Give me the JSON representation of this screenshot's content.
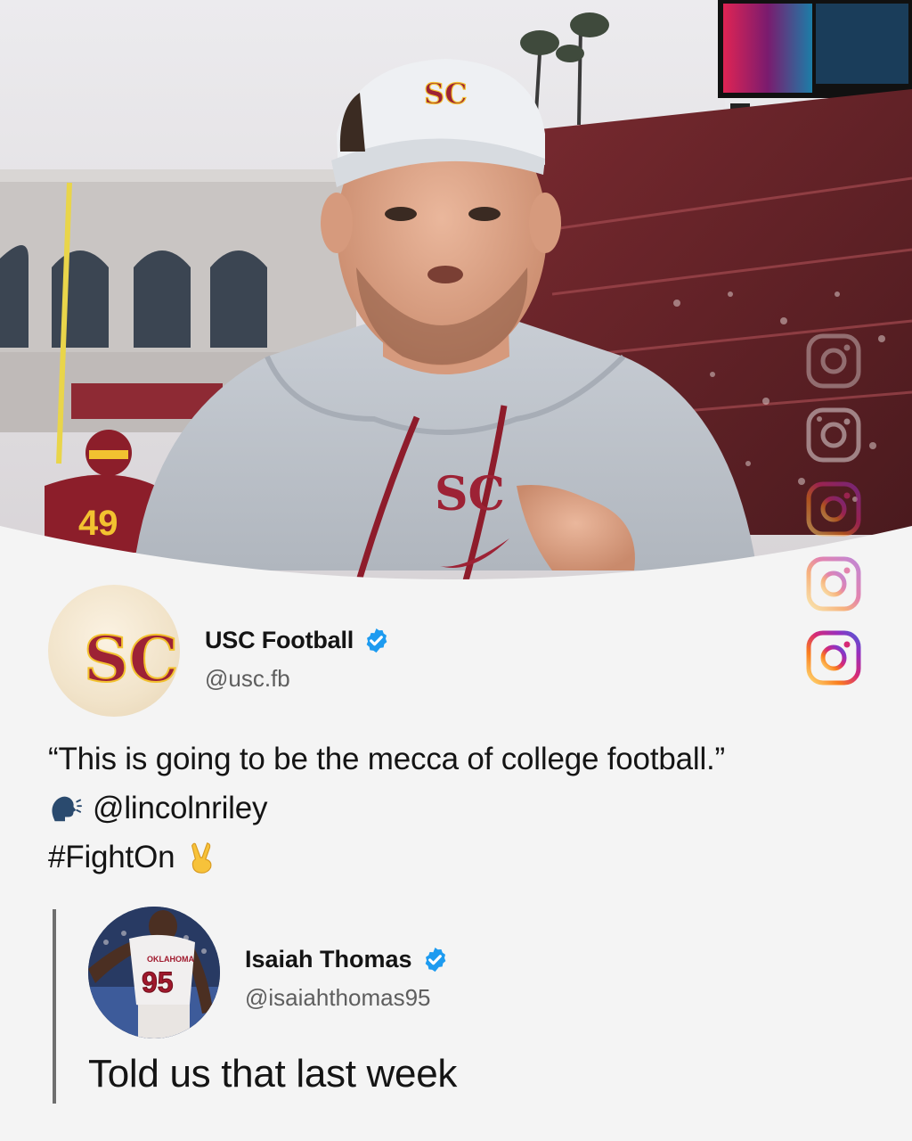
{
  "post": {
    "author": {
      "name": "USC Football",
      "handle": "@usc.fb",
      "verified": true,
      "avatar": "usc-sc-logo"
    },
    "lines": [
      {
        "text": "“This is going to be the mecca of college football.”",
        "emoji": ""
      },
      {
        "text": "@lincolnriley",
        "emoji": "speaking-head-icon"
      },
      {
        "text": "#FightOn",
        "emoji": "victory-hand-icon"
      }
    ]
  },
  "quoted_reply": {
    "author": {
      "name": "Isaiah Thomas",
      "handle": "@isaiahthomas95",
      "verified": true,
      "avatar": "oklahoma-player-95-photo"
    },
    "text": "Told us that last week"
  },
  "photo": {
    "subject": "coach-in-usc-visor-and-hoodie",
    "background": "stadium-stands",
    "visible_jersey_number": "49",
    "player_jersey_number": "95",
    "jersey_text": "OKLAHOMA"
  },
  "watermark": {
    "icon": "instagram-icon",
    "count": 5
  },
  "colors": {
    "usc_cardinal": "#9d2235",
    "usc_gold": "#ffc72c",
    "verified_blue": "#1d9bf0",
    "background": "#f4f4f4",
    "instagram_gradient": [
      "#feda75",
      "#fa7e1e",
      "#d62976",
      "#962fbf",
      "#4f5bd5"
    ]
  }
}
